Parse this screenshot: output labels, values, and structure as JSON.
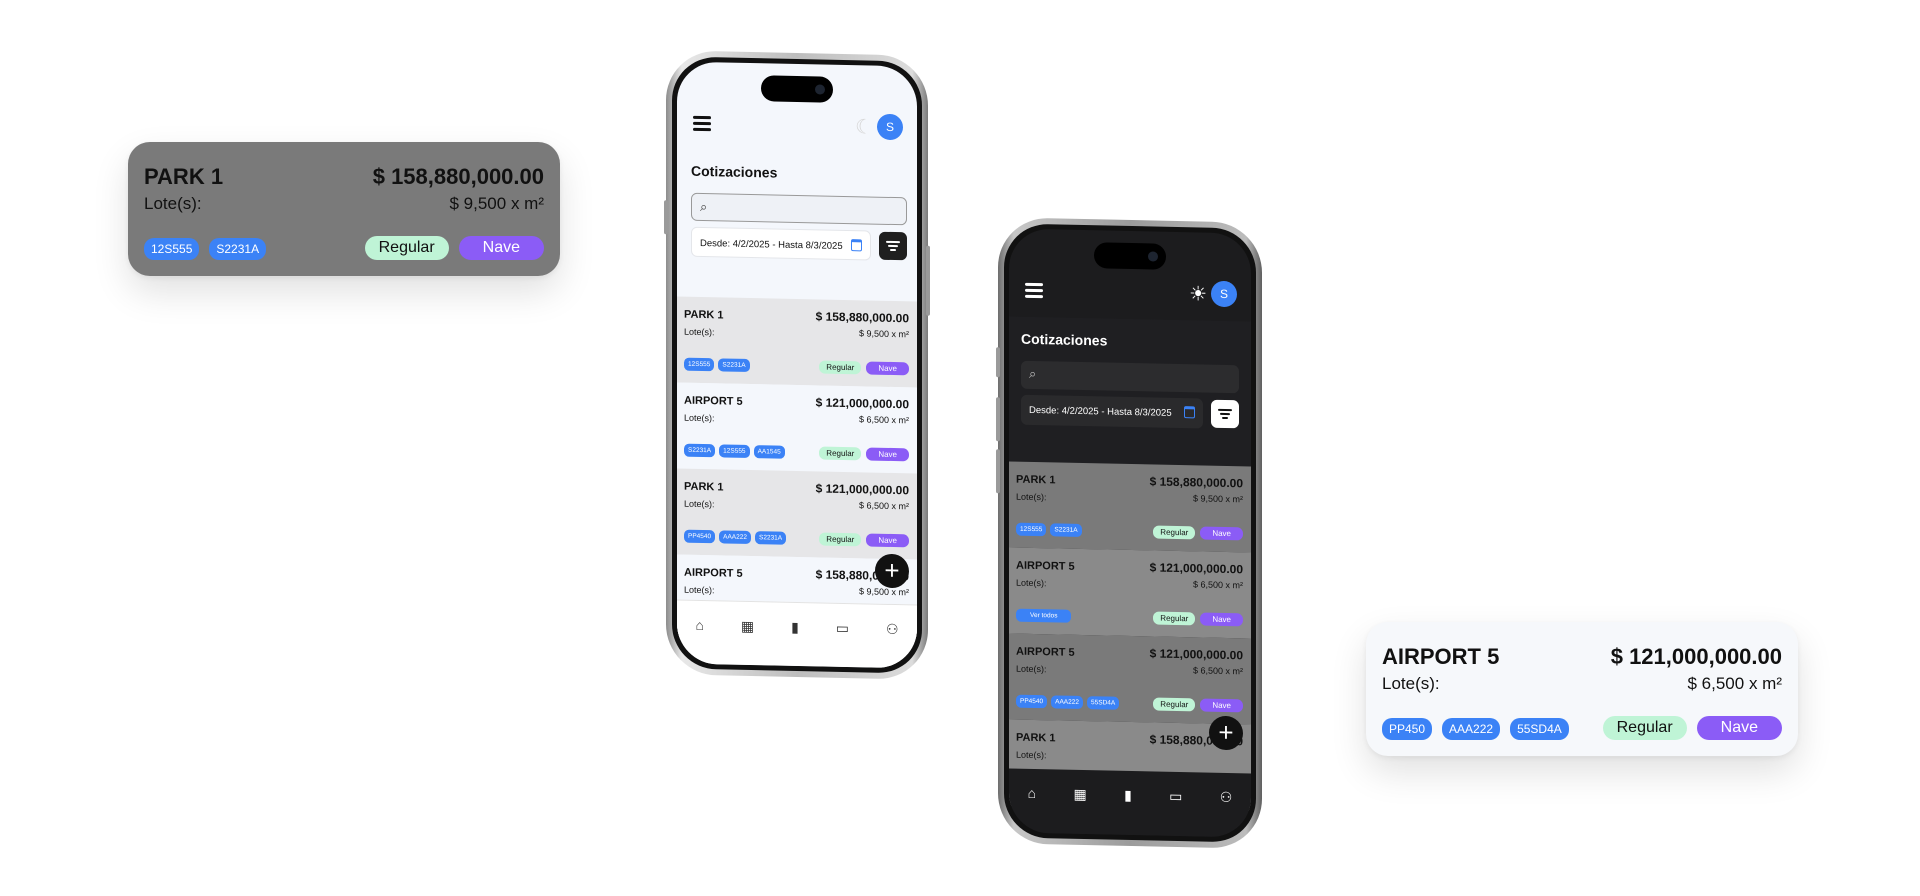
{
  "callout_dark": {
    "name": "PARK 1",
    "price": "$ 158,880,000.00",
    "lote_label": "Lote(s):",
    "rate": "$ 9,500 x m²",
    "tags": [
      "12S555",
      "S2231A"
    ],
    "status": "Regular",
    "type": "Nave"
  },
  "callout_light": {
    "name": "AIRPORT 5",
    "price": "$ 121,000,000.00",
    "lote_label": "Lote(s):",
    "rate": "$ 6,500 x m²",
    "tags": [
      "PP450",
      "AAA222",
      "55SD4A"
    ],
    "status": "Regular",
    "type": "Nave"
  },
  "app": {
    "avatar": "S",
    "title": "Cotizaciones",
    "search_placeholder": "",
    "date_range": "Desde: 4/2/2025 - Hasta 8/3/2025",
    "fab": "+",
    "nav": [
      "home-icon",
      "building-icon",
      "quote-icon",
      "image-icon",
      "users-icon"
    ]
  },
  "phone_light": {
    "theme_icon": "moon-icon",
    "cards": [
      {
        "name": "PARK 1",
        "price": "$ 158,880,000.00",
        "lote": "Lote(s):",
        "rate": "$ 9,500 x m²",
        "tags": [
          "12S555",
          "S2231A"
        ],
        "status": "Regular",
        "type": "Nave"
      },
      {
        "name": "AIRPORT 5",
        "price": "$ 121,000,000.00",
        "lote": "Lote(s):",
        "rate": "$ 6,500 x m²",
        "tags": [
          "S2231A",
          "12S555",
          "AA1545"
        ],
        "status": "Regular",
        "type": "Nave"
      },
      {
        "name": "PARK 1",
        "price": "$ 121,000,000.00",
        "lote": "Lote(s):",
        "rate": "$ 6,500 x m²",
        "tags": [
          "PP4540",
          "AAA222",
          "S2231A"
        ],
        "status": "Regular",
        "type": "Nave"
      },
      {
        "name": "AIRPORT 5",
        "price": "$ 158,880,000.00",
        "lote": "Lote(s):",
        "rate": "$ 9,500 x m²"
      }
    ]
  },
  "phone_dark": {
    "theme_icon": "sun-icon",
    "cards": [
      {
        "name": "PARK 1",
        "price": "$ 158,880,000.00",
        "lote": "Lote(s):",
        "rate": "$ 9,500 x m²",
        "tags": [
          "12S555",
          "S2231A"
        ],
        "status": "Regular",
        "type": "Nave"
      },
      {
        "name": "AIRPORT 5",
        "price": "$ 121,000,000.00",
        "lote": "Lote(s):",
        "rate": "$ 6,500 x m²",
        "tags": [
          "Ver todos"
        ],
        "status": "Regular",
        "type": "Nave"
      },
      {
        "name": "AIRPORT 5",
        "price": "$ 121,000,000.00",
        "lote": "Lote(s):",
        "rate": "$ 6,500 x m²",
        "tags": [
          "PP4540",
          "AAA222",
          "55SD4A"
        ],
        "status": "Regular",
        "type": "Nave"
      },
      {
        "name": "PARK 1",
        "price": "$ 158,880,000.00",
        "lote": "Lote(s):"
      }
    ]
  },
  "colors": {
    "accent_blue": "#3b82f6",
    "regular_green": "#bff4d6",
    "nave_purple": "#8b5cf6"
  }
}
